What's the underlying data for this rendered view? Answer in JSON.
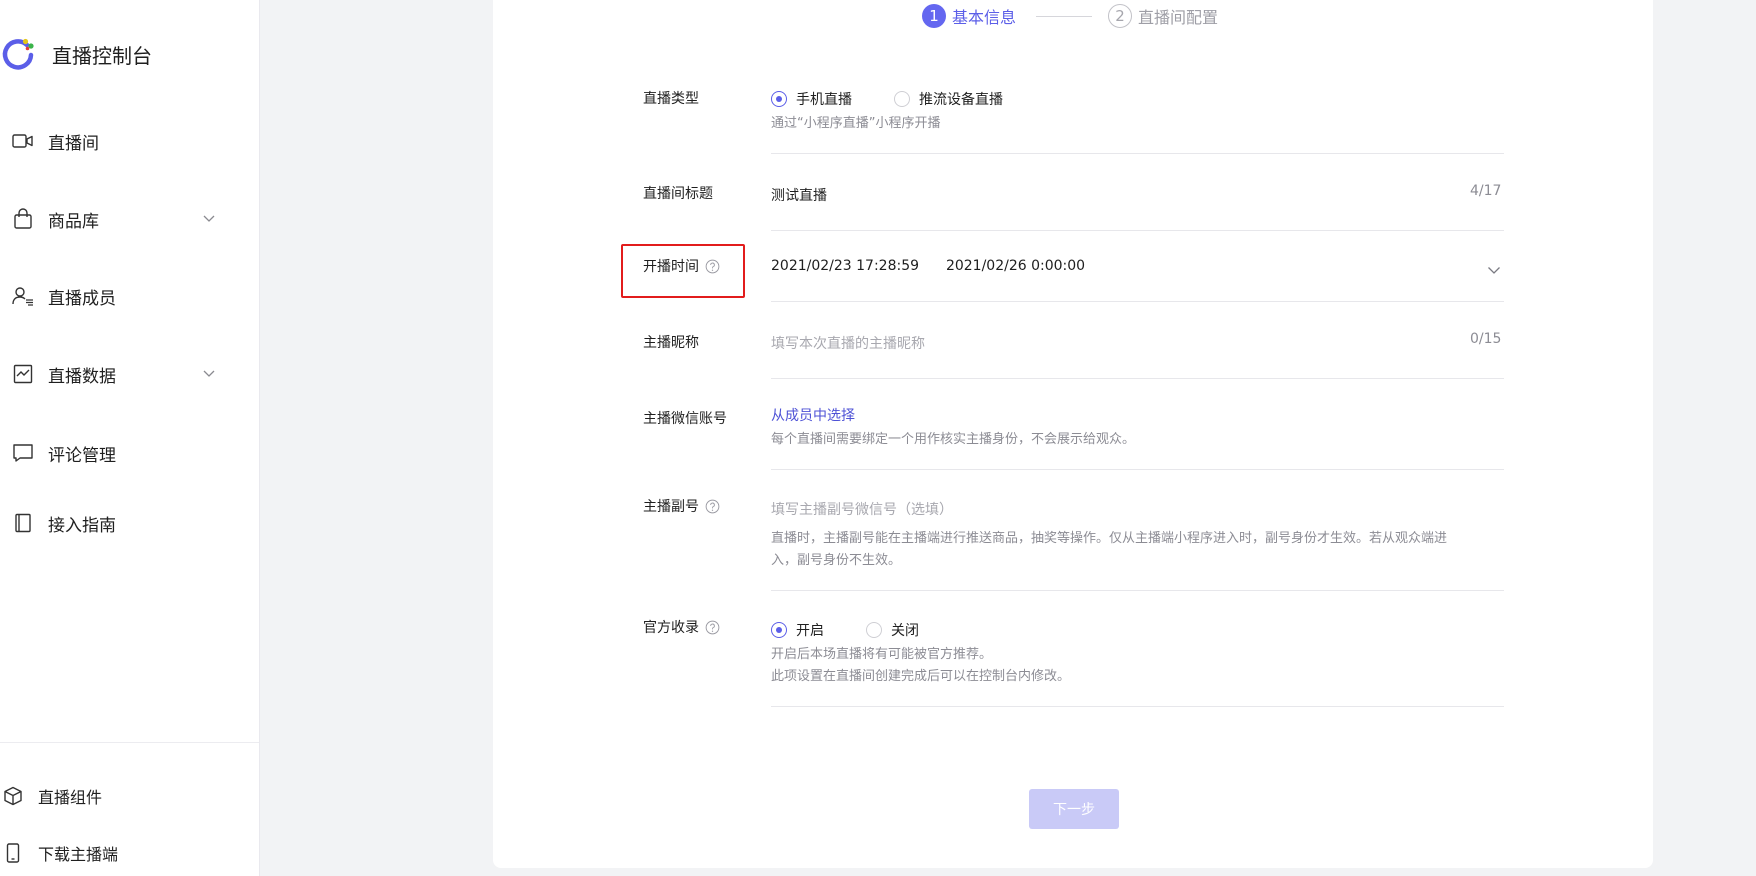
{
  "app": {
    "title": "直播控制台"
  },
  "sidebar": {
    "items": [
      {
        "label": "直播间",
        "icon": "video-camera-icon"
      },
      {
        "label": "商品库",
        "icon": "shopping-bag-icon"
      },
      {
        "label": "直播成员",
        "icon": "members-icon"
      },
      {
        "label": "直播数据",
        "icon": "chart-icon"
      },
      {
        "label": "评论管理",
        "icon": "comment-icon"
      },
      {
        "label": "接入指南",
        "icon": "book-icon"
      }
    ],
    "bottom_items": [
      {
        "label": "直播组件",
        "icon": "cube-icon"
      },
      {
        "label": "下载主播端",
        "icon": "phone-icon"
      }
    ]
  },
  "steps": [
    {
      "number": "1",
      "label": "基本信息",
      "state": "active"
    },
    {
      "number": "2",
      "label": "直播间配置",
      "state": "inactive"
    }
  ],
  "form": {
    "live_type": {
      "label": "直播类型",
      "options": [
        "手机直播",
        "推流设备直播"
      ],
      "selected": "手机直播",
      "hint": "通过“小程序直播”小程序开播"
    },
    "room_title": {
      "label": "直播间标题",
      "value": "测试直播",
      "counter": "4/17"
    },
    "start_time": {
      "label": "开播时间",
      "start": "2021/02/23 17:28:59",
      "end": "2021/02/26 0:00:00"
    },
    "anchor_nickname": {
      "label": "主播昵称",
      "placeholder": "填写本次直播的主播昵称",
      "counter": "0/15"
    },
    "anchor_wechat": {
      "label": "主播微信账号",
      "link": "从成员中选择",
      "hint": "每个直播间需要绑定一个用作核实主播身份，不会展示给观众。"
    },
    "anchor_deputy": {
      "label": "主播副号",
      "placeholder": "填写主播副号微信号（选填）",
      "hint_line1": "直播时，主播副号能在主播端进行推送商品，抽奖等操作。仅从主播端小程序进入时，副号身份才生效。若从观众端进",
      "hint_line2": "入，副号身份不生效。"
    },
    "official_index": {
      "label": "官方收录",
      "options": [
        "开启",
        "关闭"
      ],
      "selected": "开启",
      "hint_line1": "开启后本场直播将有可能被官方推荐。",
      "hint_line2": "此项设置在直播间创建完成后可以在控制台内修改。"
    }
  },
  "actions": {
    "next_label": "下一步"
  },
  "colors": {
    "accent": "#5b5ee8",
    "highlight": "#e21c1c",
    "button_disabled": "#c9caf7"
  }
}
